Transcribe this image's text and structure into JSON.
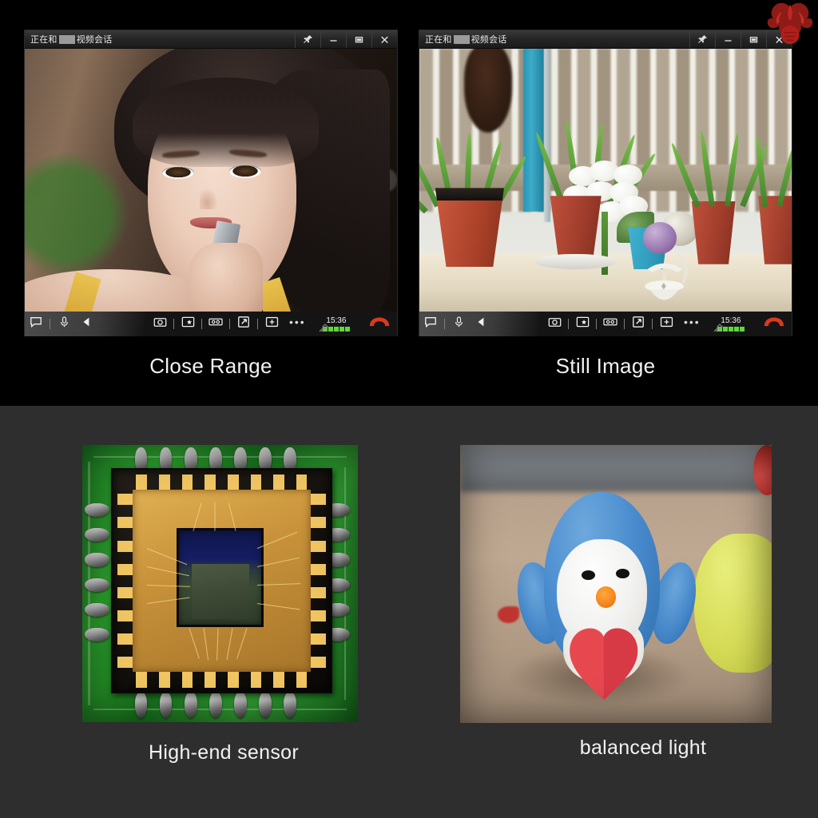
{
  "page": {
    "top_background": "#000000",
    "bottom_background": "#2e2e2e",
    "brand_logo": "phoenix-logo"
  },
  "windows": [
    {
      "id": "left-video-window",
      "titlebar": {
        "title_prefix": "正在和",
        "title_suffix": "视频会话",
        "redacted_name": true,
        "buttons": [
          {
            "name": "pin-button",
            "icon": "pin-icon",
            "label": "置顶"
          },
          {
            "name": "minimize-button",
            "icon": "minimize-icon",
            "label": "最小化"
          },
          {
            "name": "maximize-button",
            "icon": "maximize-icon",
            "label": "最大化"
          },
          {
            "name": "close-button",
            "icon": "close-icon",
            "label": "关闭"
          }
        ]
      },
      "video": {
        "scene": "close-up portrait of a young woman with dark hair, bokeh background"
      },
      "toolbar": {
        "left_icons": [
          {
            "name": "chat-button",
            "icon": "chat-bubble-icon"
          },
          {
            "name": "microphone-button",
            "icon": "microphone-icon"
          },
          {
            "name": "speaker-button",
            "icon": "speaker-icon"
          }
        ],
        "center_icons": [
          {
            "name": "snapshot-button",
            "icon": "camera-icon"
          },
          {
            "name": "magic-capture-button",
            "icon": "screenshot-star-icon"
          },
          {
            "name": "record-button",
            "icon": "film-reel-icon"
          },
          {
            "name": "share-screen-button",
            "icon": "share-arrow-icon"
          },
          {
            "name": "add-member-button",
            "icon": "add-person-icon"
          },
          {
            "name": "more-options-button",
            "icon": "ellipsis-icon"
          }
        ],
        "timer": "15:36",
        "signal_bars": 5,
        "signal_color": "#5ed73d",
        "network_icon": "satellite-icon",
        "hangup": {
          "name": "hangup-button",
          "icon": "handset-icon",
          "color": "#d93a1e"
        }
      }
    },
    {
      "id": "right-video-window",
      "titlebar": {
        "title_prefix": "正在和",
        "title_suffix": "视频会话",
        "redacted_name": true,
        "buttons": [
          {
            "name": "pin-button",
            "icon": "pin-icon",
            "label": "置顶"
          },
          {
            "name": "minimize-button",
            "icon": "minimize-icon",
            "label": "最小化"
          },
          {
            "name": "maximize-button",
            "icon": "maximize-icon",
            "label": "最大化"
          },
          {
            "name": "close-button",
            "icon": "close-icon",
            "label": "关闭"
          }
        ]
      },
      "video": {
        "scene": "balcony garden: spider plants in terracotta pots, white hydrangea, teal bucket with woven balls, wooden fence"
      },
      "toolbar": {
        "left_icons": [
          {
            "name": "chat-button",
            "icon": "chat-bubble-icon"
          },
          {
            "name": "microphone-button",
            "icon": "microphone-icon"
          },
          {
            "name": "speaker-button",
            "icon": "speaker-icon"
          }
        ],
        "center_icons": [
          {
            "name": "snapshot-button",
            "icon": "camera-icon"
          },
          {
            "name": "magic-capture-button",
            "icon": "screenshot-star-icon"
          },
          {
            "name": "record-button",
            "icon": "film-reel-icon"
          },
          {
            "name": "share-screen-button",
            "icon": "share-arrow-icon"
          },
          {
            "name": "add-member-button",
            "icon": "add-person-icon"
          },
          {
            "name": "more-options-button",
            "icon": "ellipsis-icon"
          }
        ],
        "timer": "15:36",
        "signal_bars": 5,
        "signal_color": "#5ed73d",
        "network_icon": "satellite-icon",
        "hangup": {
          "name": "hangup-button",
          "icon": "handset-icon",
          "color": "#d93a1e"
        }
      }
    }
  ],
  "captions": {
    "close_range": "Close Range",
    "still_image": "Still Image",
    "high_end_sensor": "High-end sensor",
    "balanced_light": "balanced light"
  },
  "photos": [
    {
      "id": "sensor-photo",
      "subject": "macro photo of a CMOS image sensor die on a green PCB with solder joints and gold bond wires",
      "caption_key": "high_end_sensor"
    },
    {
      "id": "penguin-photo",
      "subject": "blue plush penguin toy holding a red heart, yellow toy beside it, on a wooden desk",
      "caption_key": "balanced_light"
    }
  ]
}
